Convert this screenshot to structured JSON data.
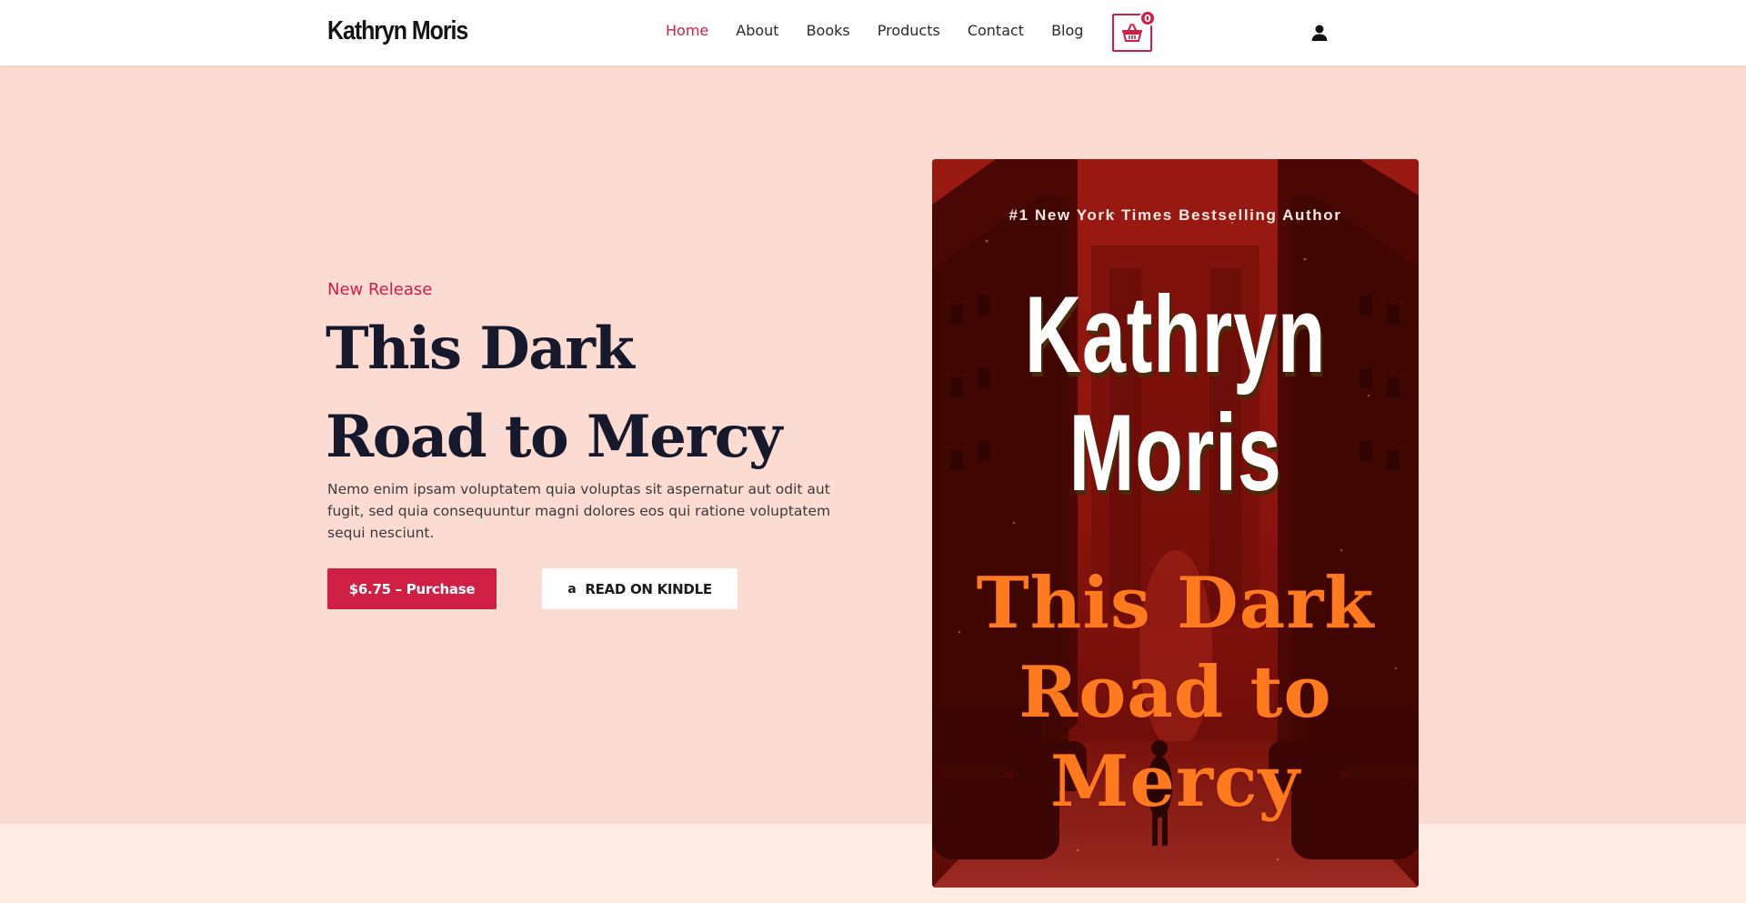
{
  "header": {
    "logo": "Kathryn Moris",
    "nav": [
      {
        "label": "Home",
        "active": true
      },
      {
        "label": "About",
        "active": false
      },
      {
        "label": "Books",
        "active": false
      },
      {
        "label": "Products",
        "active": false
      },
      {
        "label": "Contact",
        "active": false
      },
      {
        "label": "Blog",
        "active": false
      }
    ],
    "cart_count": "0",
    "cart_icon": "basket-icon",
    "user_icon": "user-icon"
  },
  "hero": {
    "eyebrow": "New Release",
    "title_line1": "This Dark",
    "title_line2": "Road to Mercy",
    "description": "Nemo enim ipsam voluptatem quia voluptas sit aspernatur aut odit aut fugit, sed quia consequuntur magni dolores eos qui ratione voluptatem sequi nesciunt.",
    "purchase_label": "$6.75 – Purchase",
    "kindle_icon": "amazon-icon",
    "kindle_label": "READ ON KINDLE"
  },
  "cover": {
    "tagline": "#1 New York Times Bestselling Author",
    "author_first": "Kathryn",
    "author_last": "Moris",
    "title_line1": "This Dark",
    "title_line2": "Road to",
    "title_line3": "Mercy"
  },
  "colors": {
    "accent": "#cf1f45",
    "hero_bg": "#fcdbd2",
    "band_bg": "#fdebe4",
    "heading": "#16192c"
  }
}
